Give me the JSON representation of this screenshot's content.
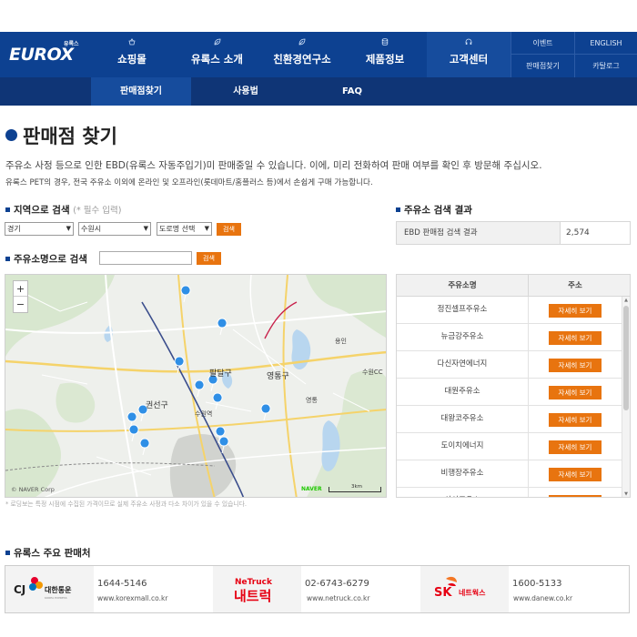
{
  "header": {
    "logo_text": "EUROX",
    "logo_sub": "유록스",
    "menu": [
      {
        "label": "쇼핑몰",
        "icon": "basket-icon"
      },
      {
        "label": "유록스 소개",
        "icon": "leaf-icon"
      },
      {
        "label": "친환경연구소",
        "icon": "leaf-icon"
      },
      {
        "label": "제품정보",
        "icon": "database-icon"
      },
      {
        "label": "고객센터",
        "icon": "headset-icon"
      }
    ],
    "utility": [
      "이벤트",
      "ENGLISH",
      "판매점찾기",
      "카탈로그"
    ]
  },
  "subnav": [
    "판매점찾기",
    "사용법",
    "FAQ"
  ],
  "page": {
    "title": "판매점 찾기",
    "desc1": "주유소 사정 등으로 인한 EBD(유록스 자동주입기)미 판매중일 수 있습니다. 이에, 미리 전화하여 판매 여부를 확인 후 방문해 주십시오.",
    "desc2": "유록스 PET의 경우, 전국 주유소 이외에 온라인 및 오프라인(롯데마트/홈플러스 등)에서 손쉽게 구매 가능합니다."
  },
  "region_search": {
    "heading": "지역으로 검색",
    "required": "(* 필수 입력)",
    "province": "경기",
    "city": "수원시",
    "road": "도로명 선택",
    "button": "검색"
  },
  "name_search": {
    "heading": "주유소명으로 검색",
    "placeholder": "",
    "button": "검색"
  },
  "result": {
    "heading": "주유소 검색 결과",
    "label": "EBD 판매점 검색 결과",
    "count": "2,574"
  },
  "map": {
    "zoom_in": "+",
    "zoom_out": "−",
    "credit": "© NAVER Corp",
    "naver": "NAVER",
    "scale": "3km",
    "labels": [
      "팔달구",
      "영통구",
      "권선구",
      "수원역",
      "수원CC",
      "영통",
      "용인"
    ],
    "note": "* 로딩보는 특정 시점에 수집된 가격이므로 실제 주유소 사정과 다소 차이가 있을 수 있습니다."
  },
  "stations": {
    "col_name": "주유소명",
    "col_addr": "주소",
    "button": "자세히 보기",
    "rows": [
      "정진셀프주유소",
      "뉴금강주유소",
      "다신자연에너지",
      "대원주유소",
      "대왕코주유소",
      "도이치에너지",
      "비행장주유소",
      "삼성주유소"
    ]
  },
  "distributors": {
    "heading": "유록스 주요 판매처",
    "items": [
      {
        "logo": "CJ 대한통운",
        "phone": "1644-5146",
        "url": "www.korexmall.co.kr"
      },
      {
        "logo": "NeTruck 내트럭",
        "phone": "02-6743-6279",
        "url": "www.netruck.co.kr"
      },
      {
        "logo": "SK 네트웍스",
        "phone": "1600-5133",
        "url": "www.danew.co.kr"
      }
    ]
  },
  "colors": {
    "nav": "#0d4191",
    "subnav": "#0f3576",
    "accent": "#e8740f",
    "pin": "#2f8fe6"
  }
}
